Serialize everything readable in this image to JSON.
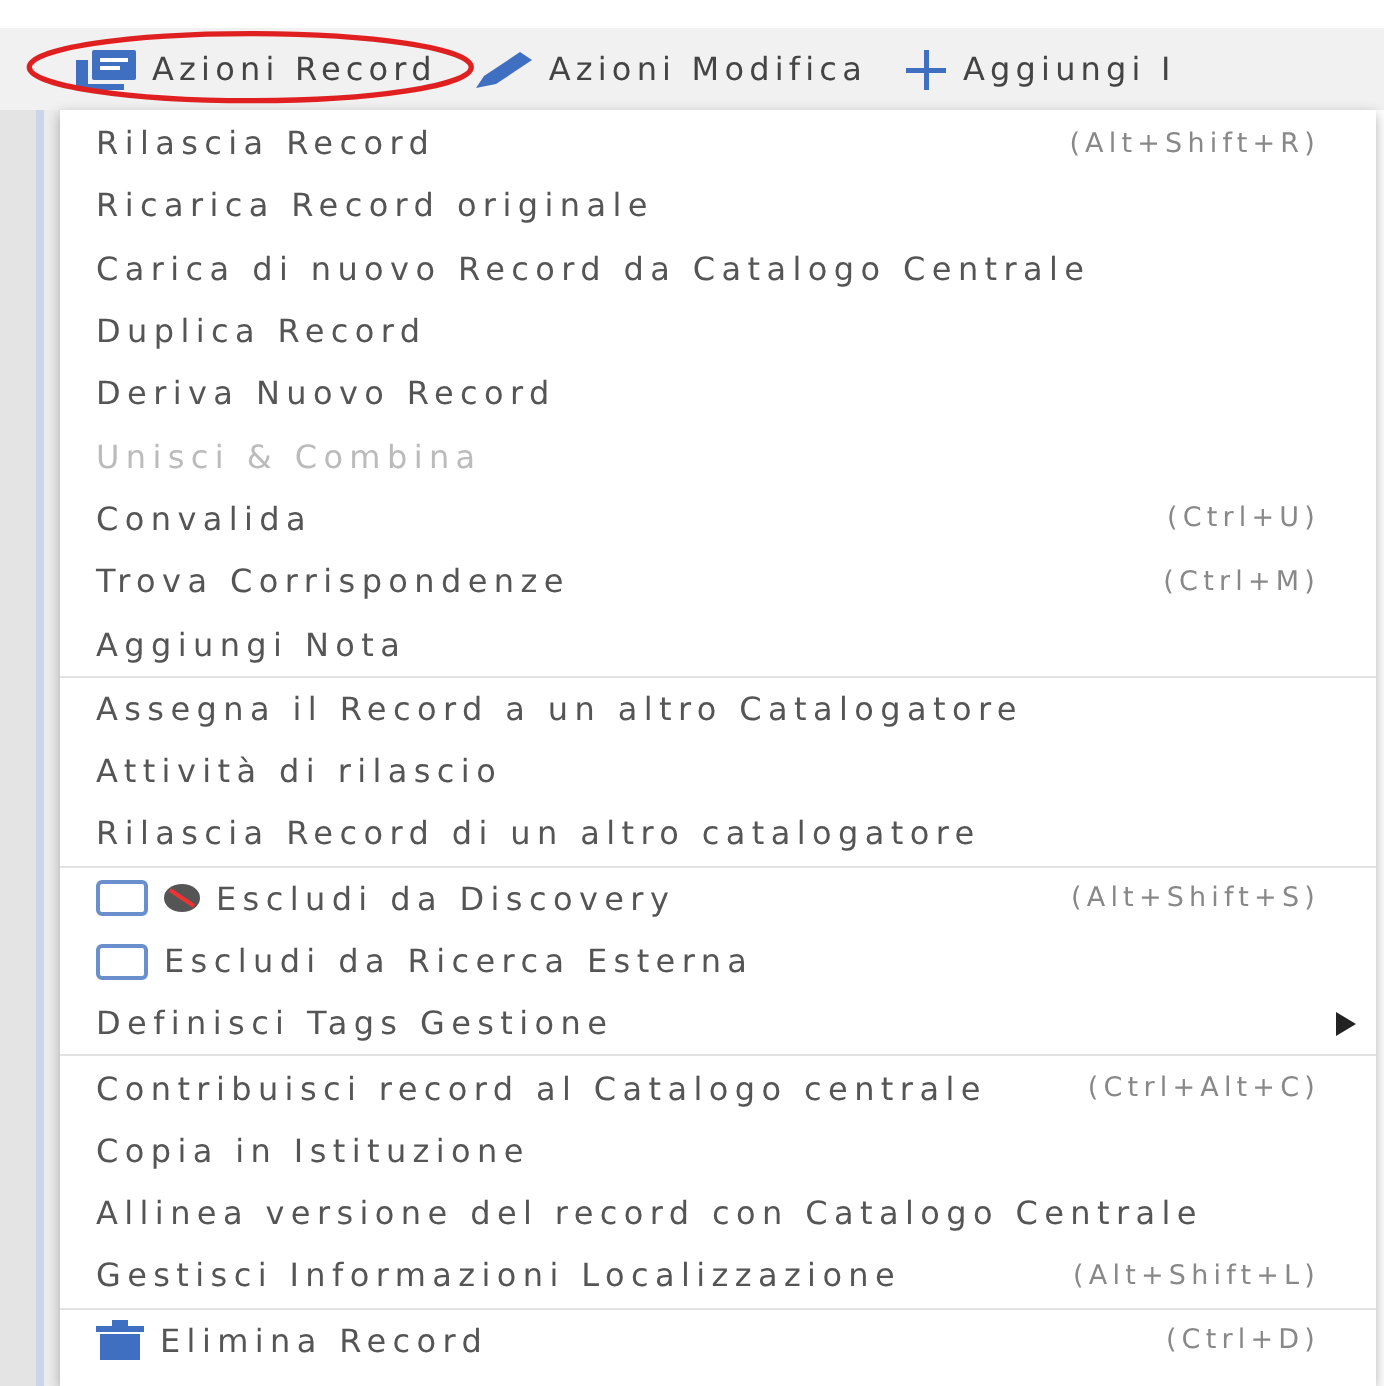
{
  "toolbar": [
    {
      "label": "Azioni Record",
      "kind": "record",
      "circled": true
    },
    {
      "label": "Azioni Modifica",
      "kind": "edit",
      "circled": false
    },
    {
      "label": "Aggiungi I",
      "kind": "add",
      "circled": false
    }
  ],
  "menu": {
    "groups": [
      {
        "items": [
          {
            "label": "Rilascia Record",
            "kind": "action",
            "disabled": false,
            "shortcut": "(Alt+Shift+R)"
          },
          {
            "label": "Ricarica Record originale",
            "kind": "action",
            "disabled": false
          },
          {
            "label": "Carica di nuovo Record da Catalogo Centrale",
            "kind": "action",
            "disabled": false
          },
          {
            "label": "Duplica Record",
            "kind": "action",
            "disabled": false
          },
          {
            "label": "Deriva Nuovo Record",
            "kind": "action",
            "disabled": false
          },
          {
            "label": "Unisci & Combina",
            "kind": "action",
            "disabled": true
          },
          {
            "label": "Convalida",
            "kind": "action",
            "disabled": false,
            "shortcut": "(Ctrl+U)"
          },
          {
            "label": "Trova Corrispondenze",
            "kind": "action",
            "disabled": false,
            "shortcut": "(Ctrl+M)"
          },
          {
            "label": "Aggiungi Nota",
            "kind": "action",
            "disabled": false
          }
        ]
      },
      {
        "items": [
          {
            "label": "Assegna il Record a un altro Catalogatore",
            "kind": "action",
            "disabled": false
          },
          {
            "label": "Attività di rilascio",
            "kind": "action",
            "disabled": false
          },
          {
            "label": "Rilascia Record di un altro catalogatore",
            "kind": "action",
            "disabled": false
          }
        ]
      },
      {
        "items": [
          {
            "label": "Escludi da Discovery",
            "kind": "checkbox-blocked",
            "checked": false,
            "disabled": false,
            "shortcut": "(Alt+Shift+S)"
          },
          {
            "label": "Escludi da Ricerca Esterna",
            "kind": "checkbox",
            "checked": false,
            "disabled": false
          },
          {
            "label": "Definisci Tags Gestione",
            "kind": "submenu",
            "disabled": false
          }
        ]
      },
      {
        "items": [
          {
            "label": "Contribuisci record al Catalogo centrale",
            "kind": "action",
            "disabled": false,
            "shortcut": "(Ctrl+Alt+C)"
          },
          {
            "label": "Copia in Istituzione",
            "kind": "action",
            "disabled": false
          },
          {
            "label": "Allinea versione del record con Catalogo Centrale",
            "kind": "action",
            "disabled": false
          },
          {
            "label": "Gestisci Informazioni Localizzazione",
            "kind": "action",
            "disabled": false,
            "shortcut": "(Alt+Shift+L)"
          }
        ]
      },
      {
        "items": [
          {
            "label": "Elimina Record",
            "kind": "delete",
            "disabled": false,
            "shortcut": "(Ctrl+D)"
          }
        ]
      }
    ]
  }
}
